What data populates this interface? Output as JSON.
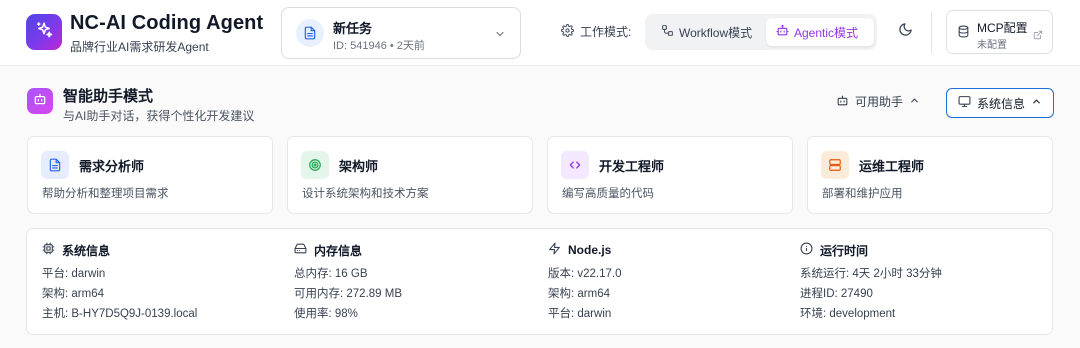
{
  "app": {
    "title": "NC-AI Coding Agent",
    "subtitle": "品牌行业AI需求研发Agent",
    "logo_icon": "sparkles-icon",
    "brand_gradient": [
      "#4f46e5",
      "#c026d3"
    ]
  },
  "task": {
    "title": "新任务",
    "meta": "ID: 541946  •  2天前",
    "icon": "document-icon"
  },
  "mode": {
    "label": "工作模式:",
    "options": [
      "Workflow模式",
      "Agentic模式"
    ],
    "selected": "Agentic模式",
    "accent": "#9333ea"
  },
  "mcp": {
    "title": "MCP配置",
    "status": "未配置"
  },
  "section": {
    "title": "智能助手模式",
    "subtitle": "与AI助手对话，获得个性化开发建议",
    "available_label": "可用助手",
    "sysinfo_label": "系统信息"
  },
  "assistants": [
    {
      "name": "需求分析师",
      "desc": "帮助分析和整理项目需求",
      "icon": "document-icon",
      "color": "#2563eb"
    },
    {
      "name": "架构师",
      "desc": "设计系统架构和技术方案",
      "icon": "target-icon",
      "color": "#16a34a"
    },
    {
      "name": "开发工程师",
      "desc": "编写高质量的代码",
      "icon": "code-icon",
      "color": "#9333ea"
    },
    {
      "name": "运维工程师",
      "desc": "部署和维护应用",
      "icon": "server-icon",
      "color": "#ea580c"
    }
  ],
  "system_info": {
    "system": {
      "title": "系统信息",
      "lines": [
        "平台: darwin",
        "架构: arm64",
        "主机: B-HY7D5Q9J-0139.local"
      ]
    },
    "memory": {
      "title": "内存信息",
      "lines": [
        "总内存: 16 GB",
        "可用内存: 272.89 MB",
        "使用率: 98%"
      ]
    },
    "node": {
      "title": "Node.js",
      "lines": [
        "版本: v22.17.0",
        "架构: arm64",
        "平台: darwin"
      ]
    },
    "uptime": {
      "title": "运行时间",
      "lines": [
        "系统运行: 4天 2小时 33分钟",
        "进程ID: 27490",
        "环境: development"
      ]
    }
  }
}
